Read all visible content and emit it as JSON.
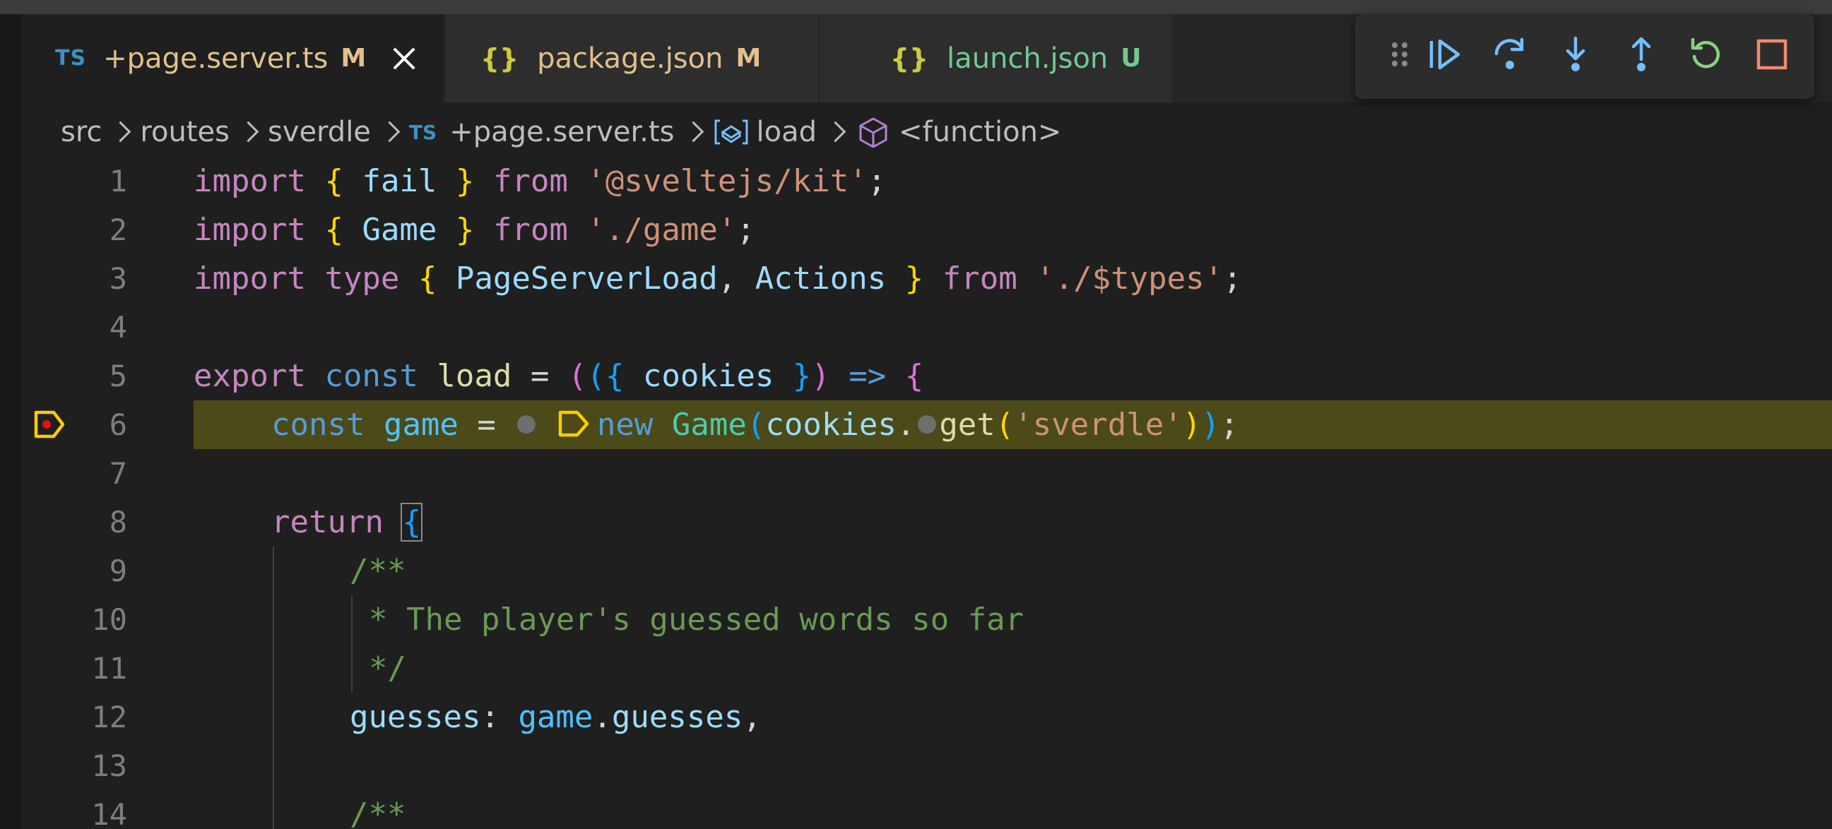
{
  "tabs": [
    {
      "icon": "TS",
      "label": "+page.server.ts",
      "status": "M",
      "status_color": "#e2c08d",
      "label_color": "#e2c08d",
      "active": true
    },
    {
      "icon": "{}",
      "label": "package.json",
      "status": "M",
      "status_color": "#e2c08d",
      "label_color": "#e2c08d",
      "active": false
    },
    {
      "icon": "{}",
      "label": "launch.json",
      "status": "U",
      "status_color": "#73c991",
      "label_color": "#73c991",
      "active": false
    }
  ],
  "debug_toolbar": {
    "buttons": [
      {
        "name": "drag-handle-icon",
        "title": "Drag"
      },
      {
        "name": "continue-icon",
        "title": "Continue"
      },
      {
        "name": "step-over-icon",
        "title": "Step Over"
      },
      {
        "name": "step-into-icon",
        "title": "Step Into"
      },
      {
        "name": "step-out-icon",
        "title": "Step Out"
      },
      {
        "name": "restart-icon",
        "title": "Restart"
      },
      {
        "name": "stop-icon",
        "title": "Stop"
      }
    ]
  },
  "breadcrumb": {
    "items": [
      "src",
      "routes",
      "sverdle",
      "+page.server.ts",
      "load",
      "<function>"
    ],
    "file_icon": "TS"
  },
  "editor": {
    "line_numbers": [
      "1",
      "2",
      "3",
      "4",
      "5",
      "6",
      "7",
      "8",
      "9",
      "10",
      "11",
      "12",
      "13",
      "14"
    ],
    "paused_line": "6",
    "code": {
      "l1": [
        "import",
        "{",
        "fail",
        "}",
        "from",
        "'@sveltejs/kit'",
        ";"
      ],
      "l2": [
        "import",
        "{",
        "Game",
        "}",
        "from",
        "'./game'",
        ";"
      ],
      "l3": [
        "import",
        "type",
        "{",
        "PageServerLoad",
        ",",
        "Actions",
        "}",
        "from",
        "'./$types'",
        ";"
      ],
      "l5": [
        "export",
        "const",
        "load",
        "=",
        "(",
        "(",
        "{",
        "cookies",
        "}",
        ")",
        "=>",
        "{"
      ],
      "l6": [
        "const",
        "game",
        "=",
        "new",
        "Game",
        "(",
        "cookies",
        ".",
        "get",
        "(",
        "'sverdle'",
        ")",
        ")",
        ";"
      ],
      "l8": [
        "return",
        "{"
      ],
      "l9": [
        "/**"
      ],
      "l10": [
        "* The player's guessed words so far"
      ],
      "l11": [
        "*/"
      ],
      "l12": [
        "guesses",
        ":",
        "game",
        ".",
        "guesses",
        ","
      ],
      "l14": [
        "/**"
      ]
    }
  },
  "colors": {
    "keyword": "#c586c0",
    "storage": "#569cd6",
    "string": "#ce9178",
    "comment": "#6a9955",
    "highlight": "#4b4a18",
    "breakpoint": "#ffcc00"
  }
}
